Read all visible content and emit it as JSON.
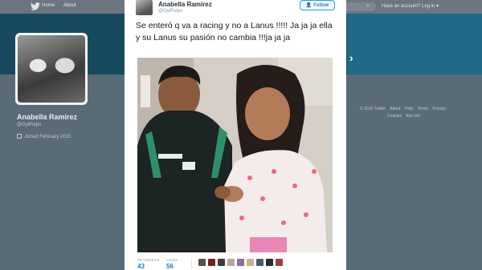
{
  "topnav": {
    "home": "Home",
    "about": "About",
    "account": "Have an account? Log in ▾"
  },
  "profile": {
    "name": "Anabella Ramirez",
    "handle": "@GylPulpo",
    "joined": "Joined February 2015"
  },
  "footer": {
    "row1": [
      "© 2016 Twitter",
      "About",
      "Help",
      "Terms",
      "Privacy"
    ],
    "row2": [
      "Cookies",
      "Ads info"
    ]
  },
  "tweet": {
    "author_name": "Anabella Ramírez",
    "author_handle": "@GylPulpo",
    "follow_label": "Follow",
    "text": "Se enteró q va a racing y no a Lanus !!!!! Ja ja ja ella y su Lanus su pasión no cambia !!!ja ja ja",
    "retweets_label": "RETWEETS",
    "retweets": "43",
    "likes_label": "LIKES",
    "likes": "56"
  },
  "colors": {
    "accent": "#1da1f2",
    "banner": "#174a5e"
  }
}
